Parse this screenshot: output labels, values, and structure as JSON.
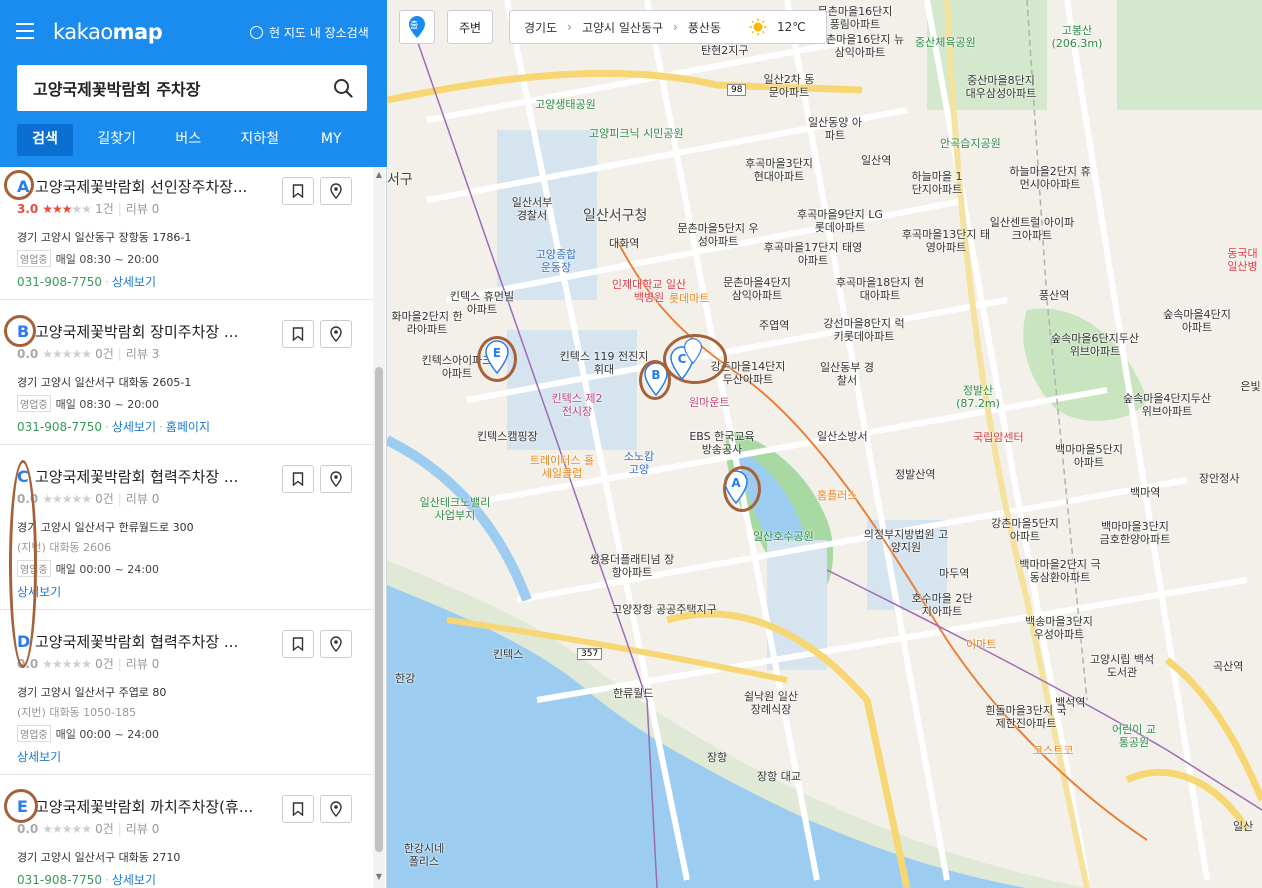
{
  "header": {
    "logo_light": "kakao",
    "logo_bold": "map",
    "current_map_search": "현 지도 내 장소검색"
  },
  "search": {
    "query": "고양국제꽃박람회 주차장"
  },
  "tabs": [
    {
      "label": "검색"
    },
    {
      "label": "길찾기"
    },
    {
      "label": "버스"
    },
    {
      "label": "지하철"
    },
    {
      "label": "MY"
    }
  ],
  "results": [
    {
      "marker": "A",
      "title": "고양국제꽃박람회 선인장주차장...",
      "score": "3.0",
      "stars_on": 3,
      "count": "1건",
      "review": "리뷰 0",
      "address": "경기 고양시 일산동구 장항동 1786-1",
      "lot": "",
      "status": "영업중",
      "hours": "매일 08:30 ~ 20:00",
      "phone": "031-908-7750",
      "detail": "상세보기",
      "homepage": ""
    },
    {
      "marker": "B",
      "title": "고양국제꽃박람회 장미주차장 ...",
      "score": "0.0",
      "stars_on": 0,
      "count": "0건",
      "review": "리뷰 3",
      "address": "경기 고양시 일산서구 대화동 2605-1",
      "lot": "",
      "status": "영업중",
      "hours": "매일 08:30 ~ 20:00",
      "phone": "031-908-7750",
      "detail": "상세보기",
      "homepage": "홈페이지"
    },
    {
      "marker": "C",
      "title": "고양국제꽃박람회 협력주차장 ...",
      "score": "0.0",
      "stars_on": 0,
      "count": "0건",
      "review": "리뷰 0",
      "address": "경기 고양시 일산서구 한류월드로 300",
      "lot": "(지번) 대화동 2606",
      "status": "영업중",
      "hours": "매일 00:00 ~ 24:00",
      "phone": "",
      "detail": "상세보기",
      "homepage": ""
    },
    {
      "marker": "D",
      "title": "고양국제꽃박람회 협력주차장 ...",
      "score": "0.0",
      "stars_on": 0,
      "count": "0건",
      "review": "리뷰 0",
      "address": "경기 고양시 일산서구 주엽로 80",
      "lot": "(지번) 대화동 1050-185",
      "status": "영업중",
      "hours": "매일 00:00 ~ 24:00",
      "phone": "",
      "detail": "상세보기",
      "homepage": ""
    },
    {
      "marker": "E",
      "title": "고양국제꽃박람회 까치주차장(휴...",
      "score": "0.0",
      "stars_on": 0,
      "count": "0건",
      "review": "리뷰 0",
      "address": "경기 고양시 일산서구 대화동 2710",
      "lot": "",
      "status": "",
      "hours": "",
      "phone": "031-908-7750",
      "detail": "상세보기",
      "homepage": ""
    }
  ],
  "map_top": {
    "departure": "출",
    "nearby": "주변",
    "breadcrumb": [
      "경기도",
      "고양시 일산동구",
      "풍산동"
    ],
    "temperature": "12℃"
  },
  "map_labels": [
    "고양생태공원",
    "고양피크닉 시민공원",
    "일산서부 경찰서",
    "일산서구청",
    "대화역",
    "고양종합 운동장",
    "킨텍스 휴먼빌아파트",
    "인제대학교 일산백병원",
    "롯데마트",
    "킨텍스 119 전진지휘대",
    "킨텍스아이파크 아파트",
    "킨텍스 제2전시장",
    "킨텍스캠핑장",
    "트레이더스 홀세일클럽",
    "소노캄 고양",
    "EBS 한국교육 방송공사",
    "원마운트",
    "홈플러스",
    "일산호수공원",
    "정발산역",
    "일산테크노밸리 사업부지",
    "쌍용더플래티넘 장항아파트",
    "고양장항 공공주택지구",
    "킨텍스",
    "한류월드",
    "장항",
    "쉴낙원 일산 장례식장",
    "한강시네 폴리스",
    "주엽역",
    "일산동부 경찰서",
    "일산소방서",
    "의정부지방법원 고양지원",
    "마두역",
    "호수마을 2단지아파트",
    "흰돌마을3단지 국제한진아파트",
    "백석역",
    "코스트코",
    "이마트",
    "어린이 교통공원",
    "고양시립 백석도서관",
    "곡산역",
    "백마역",
    "장안정사",
    "국립암센터",
    "정발산 (87.2m)",
    "풍산역",
    "일산역",
    "고봉산 (206.3m)",
    "중산체육공원",
    "안곡습지공원",
    "후곡마을3단지 현대아파트",
    "문촌마을16단지 뉴삼익아파트",
    "강촌마을14단지 두산아파트",
    "백송마을3단지 우성아파트",
    "백마마을2단지 극동삼환아파트",
    "강촌마을5단지 아파트",
    "백마마을3단지 금호한양아파트",
    "백마마을5단지 아파트",
    "숲속마을6단지두산 위브아파트",
    "숲속마을4단지 아파트",
    "하늘마을2단지 휴먼시아아파트",
    "일산센트럴 아이파크아파트",
    "중산마을8단지 대우삼성아파트",
    "일산2차 동문아파트",
    "문촌마을16단지 풍림아파트",
    "후곡마을9단지 LG롯데아파트",
    "후곡마을17단지 태영아파트",
    "후곡마을18단지 현대아파트",
    "강선마을8단지 럭키롯데아파트",
    "문촌마을4단지 삼익아파트",
    "하늘마을 1단지아파트",
    "후곡마을13단지 태영아파트",
    "일산동양 아파트",
    "문촌마을5단지 우성아파트",
    "화마을2단지 한라아파트",
    "탄현2지구",
    "동국대 일산병",
    "서구",
    "일산",
    "한강",
    "장항 대교",
    "숲속마을4단지두산 위브아파트",
    "은빛"
  ],
  "road_numbers": [
    "98",
    "357"
  ]
}
